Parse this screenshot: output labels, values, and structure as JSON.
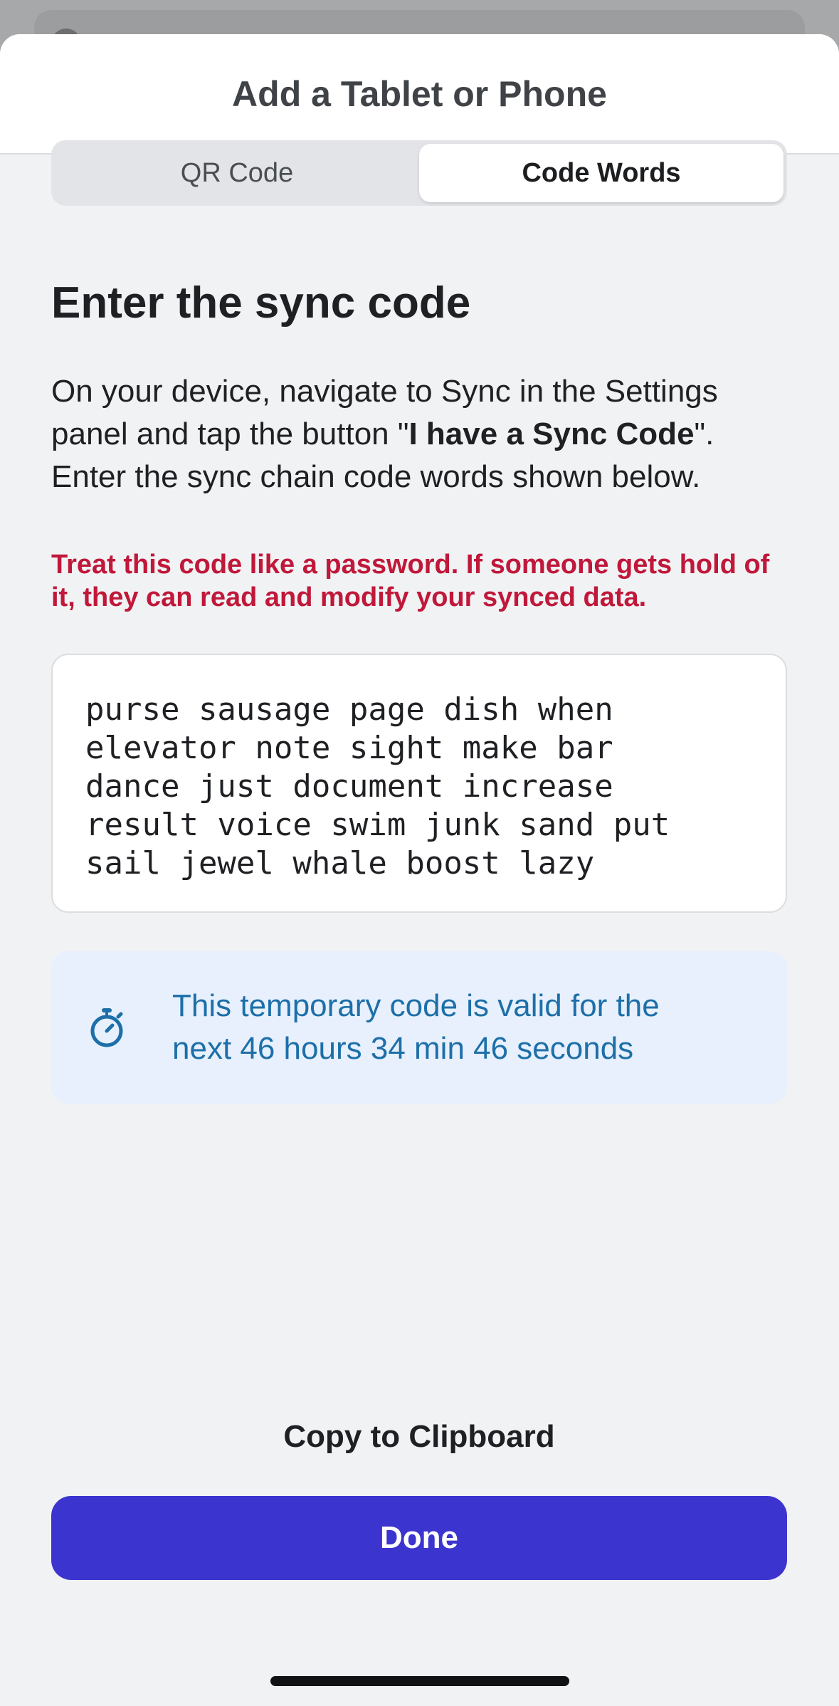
{
  "sheet": {
    "title": "Add a Tablet or Phone"
  },
  "tabs": [
    {
      "label": "QR Code",
      "active": false
    },
    {
      "label": "Code Words",
      "active": true
    }
  ],
  "content": {
    "heading": "Enter the sync code",
    "description_before": "On your device, navigate to Sync in the Settings panel and tap the button \"",
    "description_bold": "I have a Sync Code",
    "description_after": "\". Enter the sync chain code words shown below.",
    "warning": "Treat this code like a password. If someone gets hold of it, they can read and modify your synced data.",
    "code_words": "purse sausage page dish when\nelevator note sight make bar\ndance just document increase\nresult voice swim junk sand put\nsail jewel whale boost lazy",
    "timer_text_line1": "This temporary code is valid for the",
    "timer_text_line2": "next 46 hours 34 min 46 seconds"
  },
  "actions": {
    "copy_label": "Copy to Clipboard",
    "done_label": "Done"
  },
  "icons": {
    "timer": "stopwatch-icon"
  },
  "colors": {
    "accent": "#3c34cf",
    "warning": "#c0183a",
    "info_text": "#1d6fa9",
    "info_bg": "#e7f0fc"
  }
}
